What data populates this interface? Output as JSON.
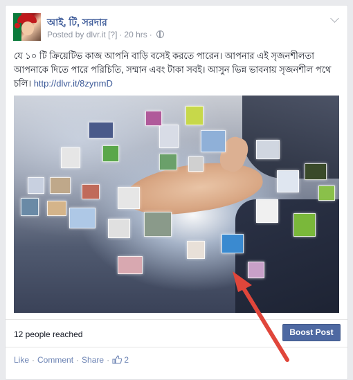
{
  "post": {
    "page_name": "আই, টি, সরদার",
    "posted_by": "Posted by dlvr.it",
    "posted_by_suffix": "[?]",
    "time": "20 hrs",
    "text": "যে ১০ টি ক্রিয়েটিভ কাজ আপনি বাড়ি বসেই করতে পারেন। আপনার এই সৃজনশীলতা আপনাকে দিতে পারে পরিচিতি, সম্মান এবং টাকা সবই। আসুন ভিন্ন ভাবনায় সৃজনশীল পথে চলি।",
    "link": "http://dlvr.it/8zynmD"
  },
  "footer": {
    "reach": "12 people reached",
    "boost_label": "Boost Post"
  },
  "actions": {
    "like": "Like",
    "comment": "Comment",
    "share": "Share",
    "like_count": "2"
  },
  "colors": {
    "link": "#3b5998",
    "boost_bg": "#4e69a2",
    "annotation_arrow": "#e0463b"
  }
}
